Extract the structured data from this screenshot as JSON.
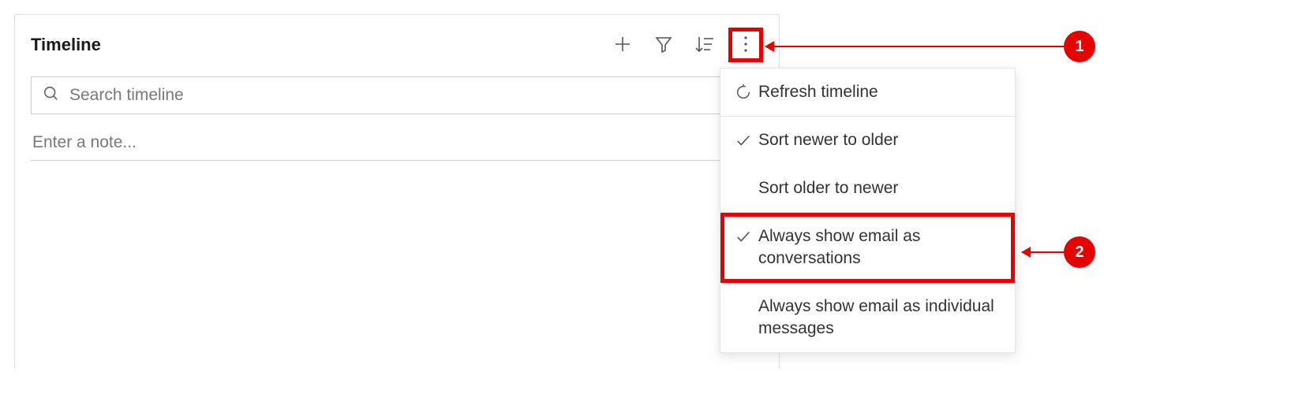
{
  "timeline": {
    "title": "Timeline",
    "search_placeholder": "Search timeline",
    "note_placeholder": "Enter a note..."
  },
  "menu": {
    "refresh": "Refresh timeline",
    "sort_newer": "Sort newer to older",
    "sort_older": "Sort older to newer",
    "email_conversations": "Always show email as conversations",
    "email_individual": "Always show email as individual messages"
  },
  "callouts": {
    "one": "1",
    "two": "2"
  }
}
